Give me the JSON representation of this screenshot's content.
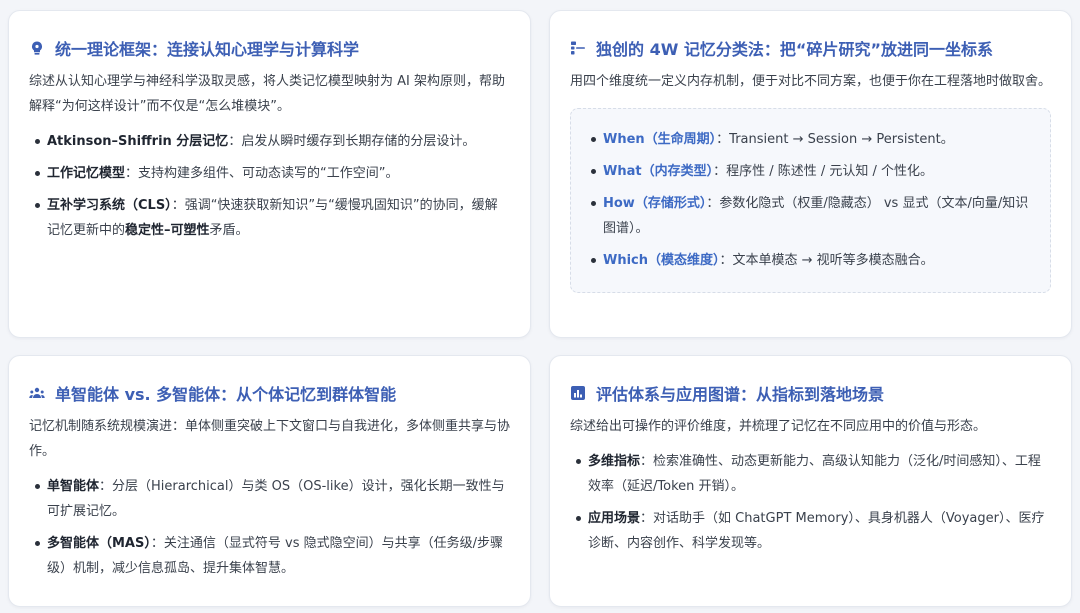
{
  "colors": {
    "accent": "#3d5fb4",
    "term_blue": "#3d6ac4",
    "background": "#f3f5f9",
    "card": "#ffffff"
  },
  "card1": {
    "icon": "brain-lightbulb-icon",
    "title": "统一理论框架：连接认知心理学与计算科学",
    "desc": "综述从认知心理学与神经科学汲取灵感，将人类记忆模型映射为 AI 架构原则，帮助解释“为何这样设计”而不仅是“怎么堆模块”。",
    "items": [
      {
        "term": "Atkinson–Shiffrin 分层记忆",
        "text": "：启发从瞬时缓存到长期存储的分层设计。"
      },
      {
        "term": "工作记忆模型",
        "text": "：支持构建多组件、可动态读写的“工作空间”。"
      },
      {
        "term": "互补学习系统（CLS）",
        "text": "：强调“快速获取新知识”与“缓慢巩固知识”的协同，缓解记忆更新中的",
        "term2": "稳定性–可塑性",
        "text2": "矛盾。"
      }
    ]
  },
  "card2": {
    "icon": "hierarchy-icon",
    "title": "独创的 4W 记忆分类法：把“碎片研究”放进同一坐标系",
    "desc": "用四个维度统一定义内存机制，便于对比不同方案，也便于你在工程落地时做取舍。",
    "items": [
      {
        "term": "When（生命周期）",
        "text": "：Transient → Session → Persistent。"
      },
      {
        "term": "What（内存类型）",
        "text": "：程序性 / 陈述性 / 元认知 / 个性化。"
      },
      {
        "term": "How（存储形式）",
        "text": "：参数化隐式（权重/隐藏态） vs 显式（文本/向量/知识图谱）。"
      },
      {
        "term": "Which（模态维度）",
        "text": "：文本单模态 → 视听等多模态融合。"
      }
    ]
  },
  "card3": {
    "icon": "users-icon",
    "title": "单智能体 vs. 多智能体：从个体记忆到群体智能",
    "desc": "记忆机制随系统规模演进：单体侧重突破上下文窗口与自我进化，多体侧重共享与协作。",
    "items": [
      {
        "term": "单智能体",
        "text": "：分层（Hierarchical）与类 OS（OS-like）设计，强化长期一致性与可扩展记忆。"
      },
      {
        "term": "多智能体（MAS）",
        "text": "：关注通信（显式符号 vs 隐式隐空间）与共享（任务级/步骤级）机制，减少信息孤岛、提升集体智慧。"
      }
    ]
  },
  "card4": {
    "icon": "bar-chart-icon",
    "title": "评估体系与应用图谱：从指标到落地场景",
    "desc": "综述给出可操作的评价维度，并梳理了记忆在不同应用中的价值与形态。",
    "items": [
      {
        "term": "多维指标",
        "text": "：检索准确性、动态更新能力、高级认知能力（泛化/时间感知）、工程效率（延迟/Token 开销）。"
      },
      {
        "term": "应用场景",
        "text": "：对话助手（如 ChatGPT Memory）、具身机器人（Voyager）、医疗诊断、内容创作、科学发现等。"
      }
    ]
  }
}
